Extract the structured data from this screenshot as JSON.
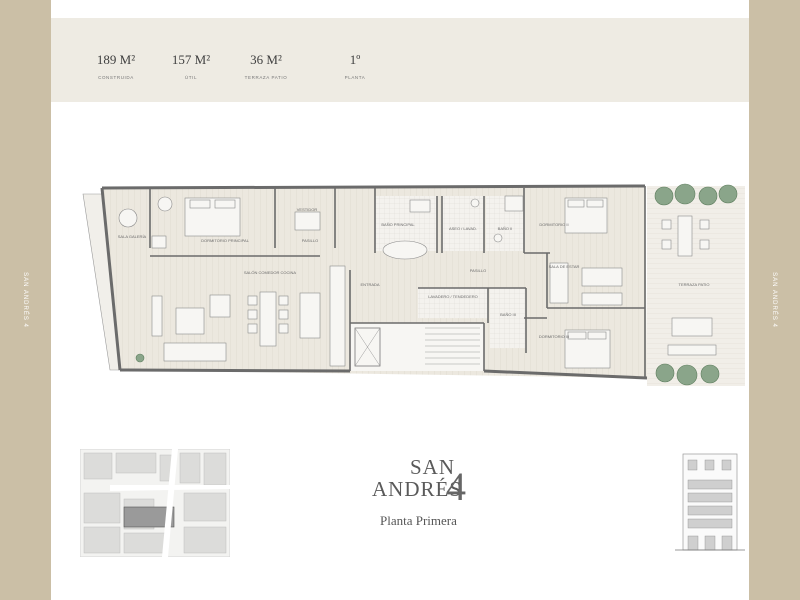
{
  "side_labels": {
    "left": "SAN ANDRÉS 4",
    "right": "SAN ANDRÉS 4"
  },
  "stats": [
    {
      "value": "189 M²",
      "label": "CONSTRUIDA"
    },
    {
      "value": "157 M²",
      "label": "ÚTIL"
    },
    {
      "value": "36 M²",
      "label": "TERRAZA PATIO"
    },
    {
      "value": "1º",
      "label": "PLANTA"
    }
  ],
  "title": {
    "line1": "SAN",
    "line2": "ANDRÉS",
    "number": "4",
    "subtitle": "Planta Primera"
  },
  "rooms": {
    "galeria": "SALA GALERÍA",
    "dorm_principal": "DORMITORIO PRINCIPAL",
    "vestidor": "VESTIDOR",
    "pasillo1": "PASILLO",
    "bano_principal": "BAÑO PRINCIPAL",
    "aseo": "ASEO / LAVAD.",
    "bano2": "BAÑO II",
    "dorm2": "DORMITORIO II",
    "salon": "SALÓN COMEDOR COCINA",
    "pasillo2": "PASILLO",
    "sala_estar": "SALA DE ESTAR",
    "entrada": "ENTRADA",
    "lavadero": "LAVADERO / TENDEDERO",
    "bano3": "BAÑO III",
    "dorm3": "DORMITORIO III",
    "terraza": "TERRAZA PATIO"
  },
  "colors": {
    "band": "#cbbfa6",
    "header": "#eeebe3",
    "floor": "#e6e2d8",
    "wall": "#6b6b6b"
  }
}
